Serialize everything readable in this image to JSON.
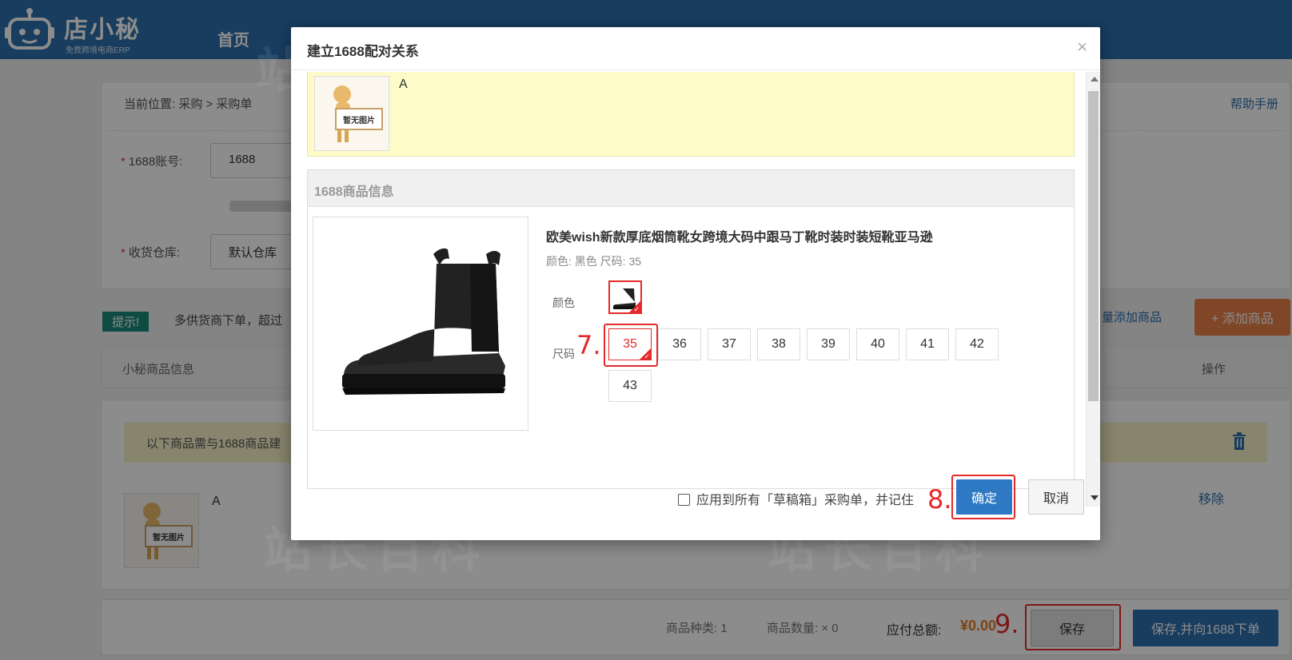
{
  "app": {
    "logo_name": "店小秘",
    "logo_sub": "免费跨境电商ERP",
    "nav_home": "首页"
  },
  "page": {
    "breadcrumb": "当前位置:  采购 > 采购单",
    "help": "帮助手册",
    "account_label": "1688账号:",
    "account_value": "1688",
    "warehouse_label": "收货仓库:",
    "warehouse_value": "默认仓库",
    "tip_badge": "提示!",
    "tip_text": "多供货商下单，超过",
    "bulk_add": "量添加商品",
    "add_goods": "+ 添加商品",
    "table_header_left": "小秘商品信息",
    "table_header_right": "操作",
    "notice": "以下商品需与1688商品建",
    "goods_name": "A",
    "goods_thumb_text": "暂无图片",
    "remove": "移除",
    "footer": {
      "kinds_label": "商品种类: 1",
      "qty_label": "商品数量: × 0",
      "total_label": "应付总额:",
      "total_value": "¥0.00",
      "save": "保存",
      "save_and_order": "保存,并向1688下单"
    }
  },
  "modal": {
    "title": "建立1688配对关系",
    "close": "×",
    "source_name": "A",
    "source_thumb_text": "暂无图片",
    "info_header": "1688商品信息",
    "product_title": "欧美wish新款厚底烟筒靴女跨境大码中跟马丁靴时装时装短靴亚马逊",
    "product_spec": "颜色: 黑色 尺码: 35",
    "color_label": "颜色",
    "size_label": "尺码",
    "sizes": [
      "35",
      "36",
      "37",
      "38",
      "39",
      "40",
      "41",
      "42",
      "43"
    ],
    "selected_size": "35",
    "apply_all": "应用到所有「草稿箱」采购单，并记住",
    "ok": "确定",
    "cancel": "取消"
  },
  "annotations": {
    "step7": "7.",
    "step8": "8.",
    "step9": "9."
  },
  "watermark": "站长百科",
  "colors": {
    "accent": "#2f78c4",
    "mark": "#e42a2a",
    "topbar": "#2c6fad",
    "orange": "#e8804a"
  }
}
